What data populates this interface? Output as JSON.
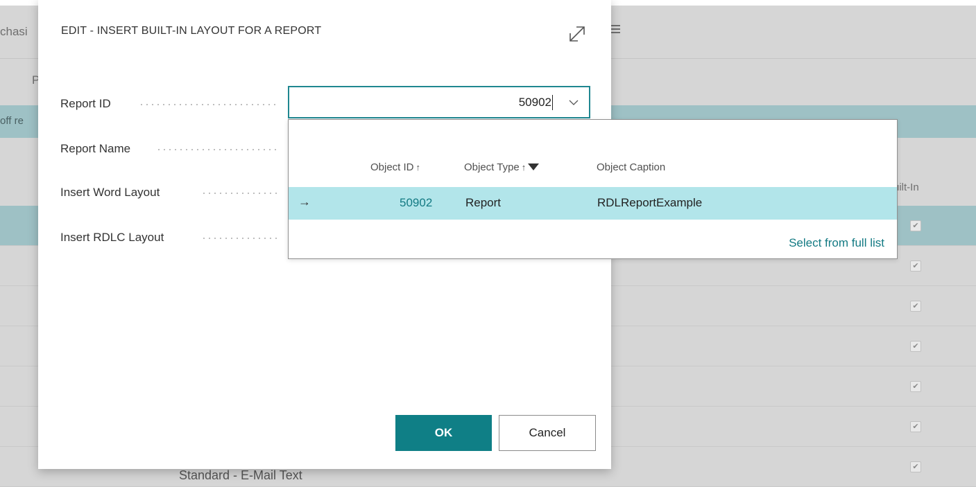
{
  "background": {
    "title_fragment": "chasi",
    "menu_icon": "hamburger-icon",
    "action_fragment": "P",
    "notice_fragment": "off re",
    "column_header_fragment": "uilt-In",
    "bottom_fragment": "Standard - E-Mail Text",
    "rows": [
      {
        "selected": true,
        "built_in": true
      },
      {
        "selected": false,
        "built_in": true
      },
      {
        "selected": false,
        "built_in": true
      },
      {
        "selected": false,
        "built_in": true
      },
      {
        "selected": false,
        "built_in": true
      },
      {
        "selected": false,
        "built_in": true
      },
      {
        "selected": false,
        "built_in": true
      }
    ]
  },
  "dialog": {
    "title": "EDIT - INSERT BUILT-IN LAYOUT FOR A REPORT",
    "expand_icon": "expand-icon",
    "fields": {
      "report_id_label": "Report ID",
      "report_name_label": "Report Name",
      "insert_word_label": "Insert Word Layout",
      "insert_rdlc_label": "Insert RDLC Layout"
    },
    "report_id_value": "50902",
    "ok_label": "OK",
    "cancel_label": "Cancel"
  },
  "lookup": {
    "columns": {
      "object_id": "Object ID",
      "object_type": "Object Type",
      "object_caption": "Object Caption",
      "sort_arrow": "↑"
    },
    "row": {
      "indicator": "→",
      "object_id": "50902",
      "object_type": "Report",
      "object_caption": "RDLReportExample"
    },
    "select_full_list": "Select from full list"
  },
  "colors": {
    "accent": "#0f7f86",
    "selected_row": "#b2e5ea",
    "link": "#137a83"
  }
}
